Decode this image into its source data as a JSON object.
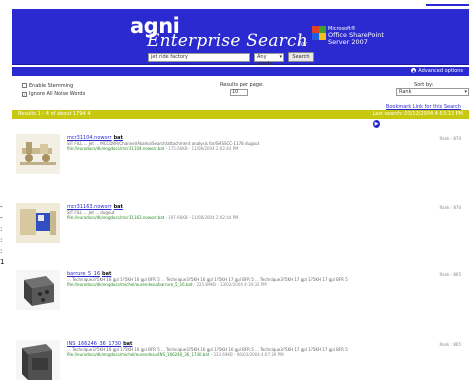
{
  "header": {
    "brand": "agni",
    "product": "Enterprise Search",
    "for_word": "for",
    "sp_line1": "Microsoft®",
    "sp_line2": "Office SharePoint",
    "sp_line3": "Server 2007"
  },
  "search": {
    "query": "jet ride factory",
    "mode": "Any words",
    "button": "Search"
  },
  "advanced": {
    "label": "Advanced options"
  },
  "options": {
    "stemming": "Enable Stemming",
    "noise": "Ignore All Noise Words",
    "noise_checked": "✓",
    "results_per_page_label": "Results per page:",
    "results_per_page": "10",
    "sort_label": "Sort by:",
    "sort_value": "Rank"
  },
  "bookmark": "Bookmark Link for this Search",
  "results_bar": {
    "info": "Results 1 - 4 of about 1794 4",
    "time": "Last search: 03/12/2004 4:53:13 PM"
  },
  "side_marks": [
    "-",
    "-",
    ":",
    ":",
    ":",
    "1"
  ],
  "results": [
    {
      "title": "mcr31104.noworr",
      "ext": "bat",
      "snippet": "SIT FILL ... Jet ... MCCDRR/Channel/AkamaiSearch/attachment analysis for/SHSSCC-1178 dugout",
      "url": "file://eurodocs/dk/engdocs/mcr31104.noworr.bat",
      "meta": " - 175.66KB - 11/08/2004 2:02:44 PM",
      "rank": "Rank : 870"
    },
    {
      "title": "mcr31163.noworr",
      "ext": "bat",
      "snippet": "SIT FILL ... Jet ... dugout",
      "url": "file://eurodocs/dk/engdocs/mcr31163.noworr.bat",
      "meta": " - 197.66KB - 11/08/2004 2:02:44 PM",
      "rank": "Rank : 870"
    },
    {
      "title": "barrure_5_16",
      "ext": "bat",
      "snippet": "... Technique3?5KH 16 gpl 1?5KH 16 gpl BFR 5 ... Technique3?5KH 16 gpl 1?5KH 17 gpl BFR 5 ... Technique3?5KH 17 gpl 1?5KH 17 gpl BFR 5",
      "url": "file://eurodocs/dk/engdocs/michel/eurendesu/barrure_5_16.bat",
      "meta": " - 225.89KB - 13/02/2004 4:34:32 PM",
      "rank": "Rank : 865"
    },
    {
      "title": "INS_166246_36_1730",
      "ext": "bat",
      "snippet": "... Technique3?5KH 16 gpl 1?5KH 16 gpl BFR 5 ... Technique3?5KH 16 gpl 1?5KH 16 gpl BFR 5 ... Technique3?5KH 17 gpl 1?5KH 17 gpl BFR 5",
      "url": "file://eurodocs/dk/engdocs/michel/eurendesu/INS_166246_36_1730.bat",
      "meta": " - 333.69KB - 06/03/2004 4:07:26 PM",
      "rank": "Rank : 865"
    }
  ]
}
